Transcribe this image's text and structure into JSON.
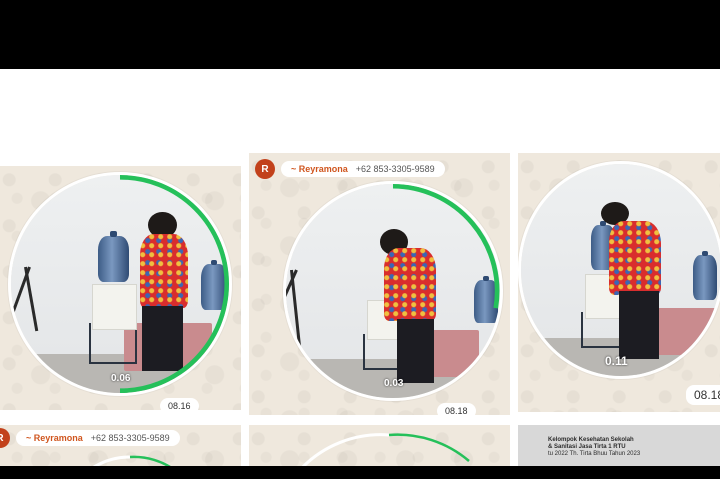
{
  "gallery": {
    "tiles": [
      {
        "duration": "0.06",
        "time": "08.16"
      },
      {
        "sender": {
          "initial": "R",
          "name": "~ Reyramona",
          "phone": "+62 853-3305-9589"
        },
        "duration": "0.03",
        "time": "08.18"
      },
      {
        "duration": "0.11",
        "time": "08.18"
      }
    ],
    "bottom_row": {
      "sender": {
        "initial": "R",
        "name": "~ Reyramona",
        "phone": "+62 853-3305-9589"
      },
      "doc_lines": [
        "Kelompok Kesehatan Sekolah",
        "& Sanitasi Jasa Tirta 1 RTU",
        "tu 2022 Th. Tirta Bhuu Tahun 2023"
      ]
    }
  }
}
